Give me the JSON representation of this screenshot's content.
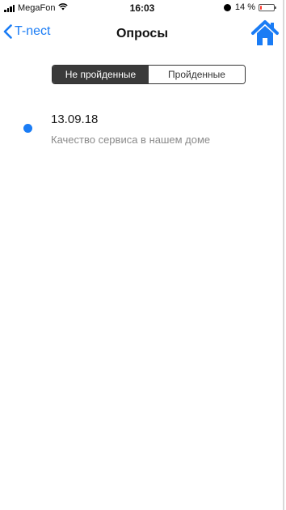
{
  "status_bar": {
    "carrier": "MegaFon",
    "time": "16:03",
    "battery_text": "14 %",
    "battery_level": 0.14,
    "battery_color": "#ff3b30"
  },
  "nav": {
    "back_label": "T-nect",
    "title": "Опросы",
    "home_icon": "home-icon",
    "accent": "#1a7cf5"
  },
  "tabs": [
    {
      "label": "Не пройденные",
      "active": true
    },
    {
      "label": "Пройденные",
      "active": false
    }
  ],
  "surveys": [
    {
      "date": "13.09.18",
      "title": "Качество сервиса в нашем доме",
      "unread": true
    }
  ]
}
